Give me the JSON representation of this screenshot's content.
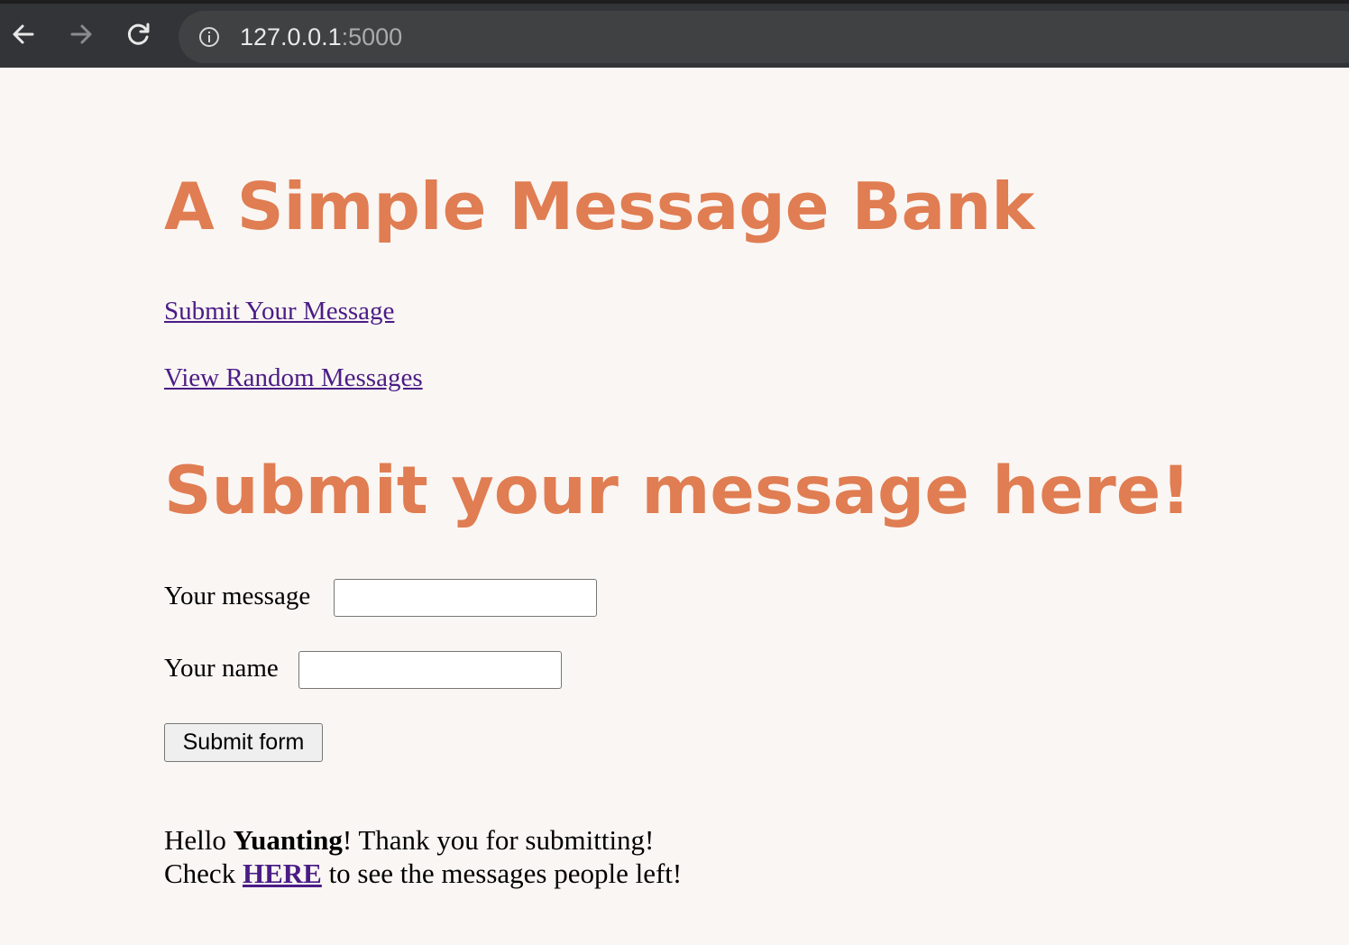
{
  "browser": {
    "url_host": "127.0.0.1",
    "url_port": ":5000",
    "icons": [
      "back-arrow-icon",
      "forward-arrow-icon",
      "reload-icon",
      "info-icon"
    ]
  },
  "page": {
    "title": "A Simple Message Bank",
    "nav_links": {
      "submit": "Submit Your Message",
      "view": "View Random Messages"
    },
    "section_title": "Submit your message here!",
    "form": {
      "message_label": "Your message",
      "message_value": "",
      "name_label": "Your name",
      "name_value": "",
      "submit_label": "Submit form"
    },
    "thanks": {
      "greeting": "Hello ",
      "user_name": "Yuanting",
      "after_name": "! Thank you for submitting!",
      "check": "Check ",
      "here_link": "HERE",
      "after_link": " to see the messages people left!"
    }
  },
  "colors": {
    "heading": "#e07d52",
    "link": "#4a1c86",
    "page_background": "#faf6f3",
    "browser_bar": "#333437"
  }
}
